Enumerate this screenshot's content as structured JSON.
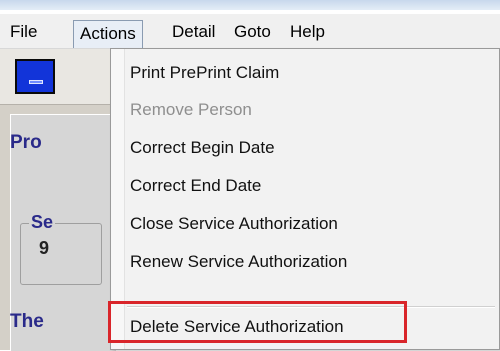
{
  "menubar": {
    "items": [
      {
        "label": "File"
      },
      {
        "label": "Actions"
      },
      {
        "label": "Detail"
      },
      {
        "label": "Goto"
      },
      {
        "label": "Help"
      }
    ]
  },
  "app": {
    "label_1": "Pro",
    "label_2": "The",
    "group_label": "Se",
    "group_value": "9"
  },
  "dropdown": {
    "items": [
      {
        "label": "Print PrePrint Claim",
        "enabled": true
      },
      {
        "label": "Remove Person",
        "enabled": false
      },
      {
        "label": "Correct Begin Date",
        "enabled": true
      },
      {
        "label": "Correct End Date",
        "enabled": true
      },
      {
        "label": "Close Service Authorization",
        "enabled": true
      },
      {
        "label": "Renew Service Authorization",
        "enabled": true
      },
      {
        "label": "Delete Service Authorization",
        "enabled": true
      }
    ]
  },
  "colors": {
    "highlight": "#d9252a",
    "app_button": "#1234d9",
    "label_text": "#2a2a8a"
  }
}
